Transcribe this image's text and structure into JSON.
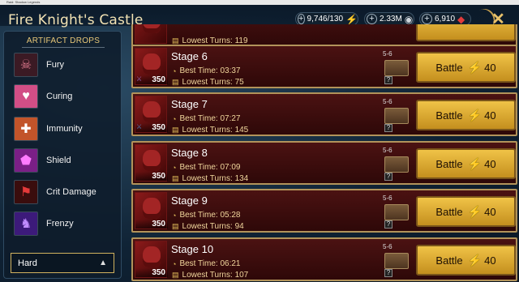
{
  "window": {
    "title": "Raid: Shadow Legends"
  },
  "header": {
    "title": "Fire Knight's Castle",
    "resources": [
      {
        "value": "9,746/130",
        "icon": "energy-icon",
        "color": "#b6e21c"
      },
      {
        "value": "2.33M",
        "icon": "silver-icon",
        "color": "#cfd6dc"
      },
      {
        "value": "6,910",
        "icon": "gem-icon",
        "color": "#e23b3b"
      }
    ]
  },
  "sidebar": {
    "title": "ARTIFACT DROPS",
    "items": [
      {
        "label": "Fury",
        "icon": "fury-set-icon",
        "color": "#7a2a3a"
      },
      {
        "label": "Curing",
        "icon": "curing-set-icon",
        "color": "#d24e86"
      },
      {
        "label": "Immunity",
        "icon": "immunity-set-icon",
        "color": "#c2542a"
      },
      {
        "label": "Shield",
        "icon": "shield-set-icon",
        "color": "#b23bb3"
      },
      {
        "label": "Crit Damage",
        "icon": "crit-damage-set-icon",
        "color": "#a51d1d"
      },
      {
        "label": "Frenzy",
        "icon": "frenzy-set-icon",
        "color": "#5b2aa3"
      }
    ],
    "difficulty": "Hard"
  },
  "stages": [
    {
      "name": "",
      "level": "",
      "best_time": "",
      "lowest_turns": "119",
      "best_time_label": "",
      "turns_label": "Lowest Turns:",
      "drop_count": "",
      "energy": ""
    },
    {
      "name": "Stage 6",
      "level": "350",
      "best_time_label": "Best Time:",
      "best_time": "03:37",
      "turns_label": "Lowest Turns:",
      "lowest_turns": "75",
      "drop_count": "5-6",
      "battle_label": "Battle",
      "energy": "40"
    },
    {
      "name": "Stage 7",
      "level": "350",
      "best_time_label": "Best Time:",
      "best_time": "07:27",
      "turns_label": "Lowest Turns:",
      "lowest_turns": "145",
      "drop_count": "5-6",
      "battle_label": "Battle",
      "energy": "40"
    },
    {
      "name": "Stage 8",
      "level": "350",
      "best_time_label": "Best Time:",
      "best_time": "07:09",
      "turns_label": "Lowest Turns:",
      "lowest_turns": "134",
      "drop_count": "5-6",
      "battle_label": "Battle",
      "energy": "40"
    },
    {
      "name": "Stage 9",
      "level": "350",
      "best_time_label": "Best Time:",
      "best_time": "05:28",
      "turns_label": "Lowest Turns:",
      "lowest_turns": "94",
      "drop_count": "5-6",
      "battle_label": "Battle",
      "energy": "40"
    },
    {
      "name": "Stage 10",
      "level": "350",
      "best_time_label": "Best Time:",
      "best_time": "06:21",
      "turns_label": "Lowest Turns:",
      "lowest_turns": "107",
      "drop_count": "5-6",
      "battle_label": "Battle",
      "energy": "40"
    }
  ],
  "battle_label": "Battle",
  "energy_cost": "40"
}
